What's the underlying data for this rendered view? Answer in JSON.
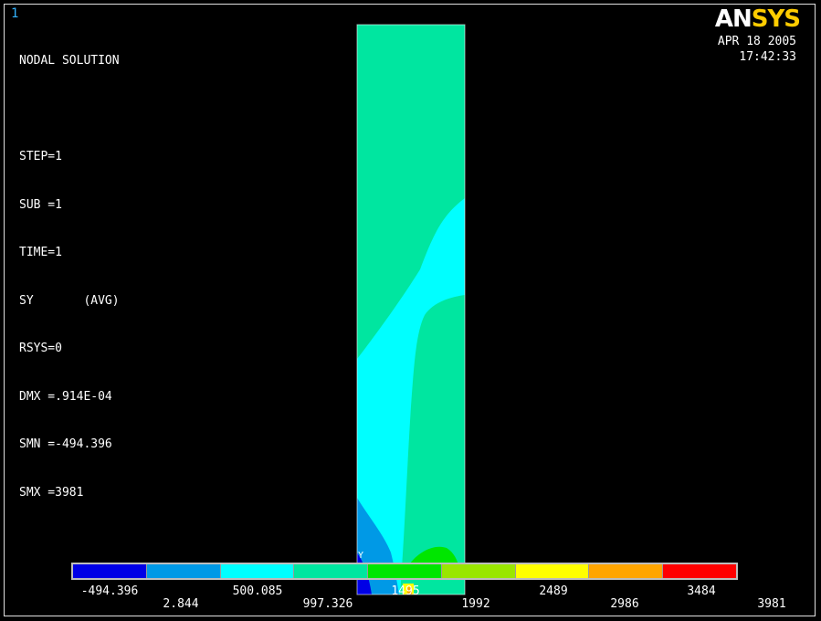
{
  "window_number": "1",
  "logo": {
    "part1": "AN",
    "part2": "SYS"
  },
  "datetime": {
    "date": "APR 18 2005",
    "time": "17:42:33"
  },
  "info": [
    "NODAL SOLUTION",
    "",
    "STEP=1",
    "SUB =1",
    "TIME=1",
    "SY       (AVG)",
    "RSYS=0",
    "DMX =.914E-04",
    "SMN =-494.396",
    "SMX =3981"
  ],
  "triad_label": "Y",
  "legend": {
    "colors": [
      "#0000e6",
      "#0099e6",
      "#00ffff",
      "#00e6a0",
      "#00e600",
      "#99e600",
      "#ffff00",
      "#ffa500",
      "#ff0000"
    ],
    "labels_top": [
      "-494.396",
      "500.085",
      "1495",
      "2489",
      "3484"
    ],
    "labels_bottom": [
      "2.844",
      "997.326",
      "1992",
      "2986",
      "3981"
    ]
  },
  "colors": {
    "background": "#000000",
    "window_number": "#33b3ff",
    "logo_accent": "#ffcc00"
  }
}
